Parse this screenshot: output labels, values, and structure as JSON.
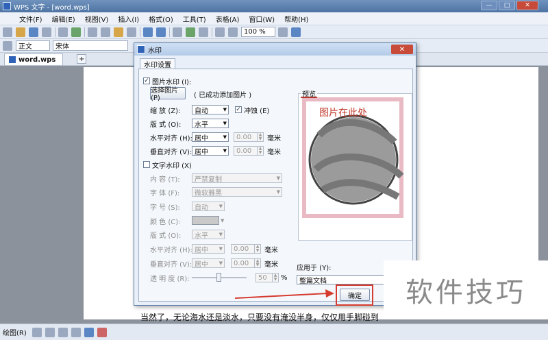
{
  "window": {
    "title": "WPS 文字 - [word.wps]"
  },
  "menu": [
    "文件(F)",
    "编辑(E)",
    "视图(V)",
    "插入(I)",
    "格式(O)",
    "工具(T)",
    "表格(A)",
    "窗口(W)",
    "帮助(H)"
  ],
  "toolbar": {
    "zoom": "100 %",
    "style": "正文",
    "font": "宋体"
  },
  "tabs": {
    "doc": "word.wps",
    "add": "+"
  },
  "dialog": {
    "title": "水印",
    "close": "✕",
    "tab": "水印设置",
    "picture_watermark": {
      "checkbox": "图片水印 (I):",
      "select_btn": "选择图片 (P)",
      "status": "( 已成功添加图片 )",
      "scale_label": "缩    放 (Z):",
      "scale_value": "自动",
      "washout": "冲蚀 (E)",
      "layout_label": "版    式 (O):",
      "layout_value": "水平",
      "halign_label": "水平对齐 (H):",
      "halign_value": "居中",
      "halign_num": "0.00",
      "valign_label": "垂直对齐 (V):",
      "valign_value": "居中",
      "valign_num": "0.00",
      "unit": "毫米"
    },
    "text_watermark": {
      "checkbox": "文字水印 (X)",
      "content_label": "内    容 (T):",
      "content_value": "严禁复制",
      "font_label": "字    体 (F):",
      "font_value": "微软雅黑",
      "size_label": "字    号 (S):",
      "size_value": "自动",
      "color_label": "颜    色 (C):",
      "layout_label": "版    式 (O):",
      "layout_value": "水平",
      "halign_label": "水平对齐 (H):",
      "halign_value": "居中",
      "halign_num": "0.00",
      "valign_label": "垂直对齐 (V):",
      "valign_value": "居中",
      "valign_num": "0.00",
      "unit": "毫米",
      "transparency_label": "透 明 度 (R):",
      "transparency_value": "50",
      "transparency_unit": "%"
    },
    "preview": {
      "label": "预览",
      "placeholder": "图片在此处"
    },
    "apply": {
      "label": "应用于 (Y):",
      "value": "整篇文档"
    },
    "ok": "确定"
  },
  "document": {
    "line": "当然了，无论海水还是淡水，只要没有淹没半身，仅仅用手脚碰到"
  },
  "drawbar": {
    "label": "绘图(R)"
  },
  "brand": "软件技巧",
  "colors": {
    "accent": "#c0392b",
    "titlebar": "#5a7eae"
  }
}
